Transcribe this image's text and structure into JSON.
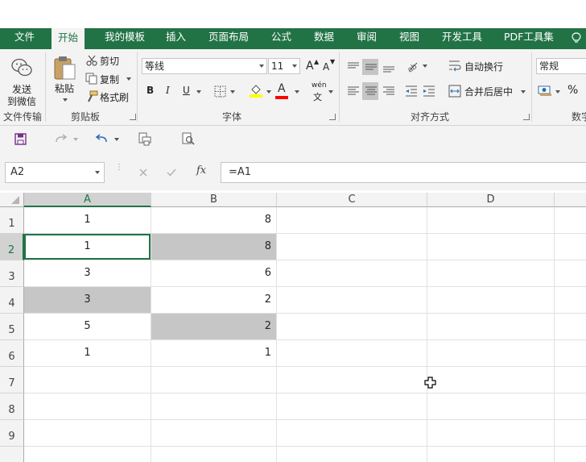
{
  "tabs": [
    "文件",
    "开始",
    "我的模板",
    "插入",
    "页面布局",
    "公式",
    "数据",
    "审阅",
    "视图",
    "开发工具",
    "PDF工具集"
  ],
  "active_tab": "开始",
  "ribbon": {
    "send_wechat": [
      "发送",
      "到微信"
    ],
    "paste": "粘贴",
    "cut": "剪切",
    "copy": "复制",
    "format_painter": "格式刷",
    "font_name": "等线",
    "font_size": "11",
    "grow_font": "A",
    "shrink_font": "A",
    "bold": "B",
    "italic": "I",
    "underline": "U",
    "phonetic": "wén",
    "font_color_letter": "A",
    "wrap_text": "自动换行",
    "merge_center": "合并后居中",
    "number_format": "常规",
    "percent": "%",
    "group_labels": {
      "file_transfer": "文件传输",
      "clipboard": "剪贴板",
      "font": "字体",
      "alignment": "对齐方式",
      "number": "数字"
    }
  },
  "formula_bar": {
    "name_box": "A2",
    "fx": "fx",
    "formula": "=A1"
  },
  "columns": [
    "A",
    "B",
    "C",
    "D"
  ],
  "rows": [
    "1",
    "2",
    "3",
    "4",
    "5",
    "6",
    "7",
    "8",
    "9"
  ],
  "cells": {
    "A": [
      "1",
      "1",
      "3",
      "3",
      "5",
      "1",
      "",
      "",
      ""
    ],
    "B": [
      "8",
      "8",
      "6",
      "2",
      "2",
      "1",
      "",
      "",
      ""
    ]
  },
  "colors": {
    "excel_green": "#217346",
    "highlight": "#c6c6c6",
    "font_color_bar": "#ff0000",
    "fill_color_bar": "#ffff00"
  }
}
